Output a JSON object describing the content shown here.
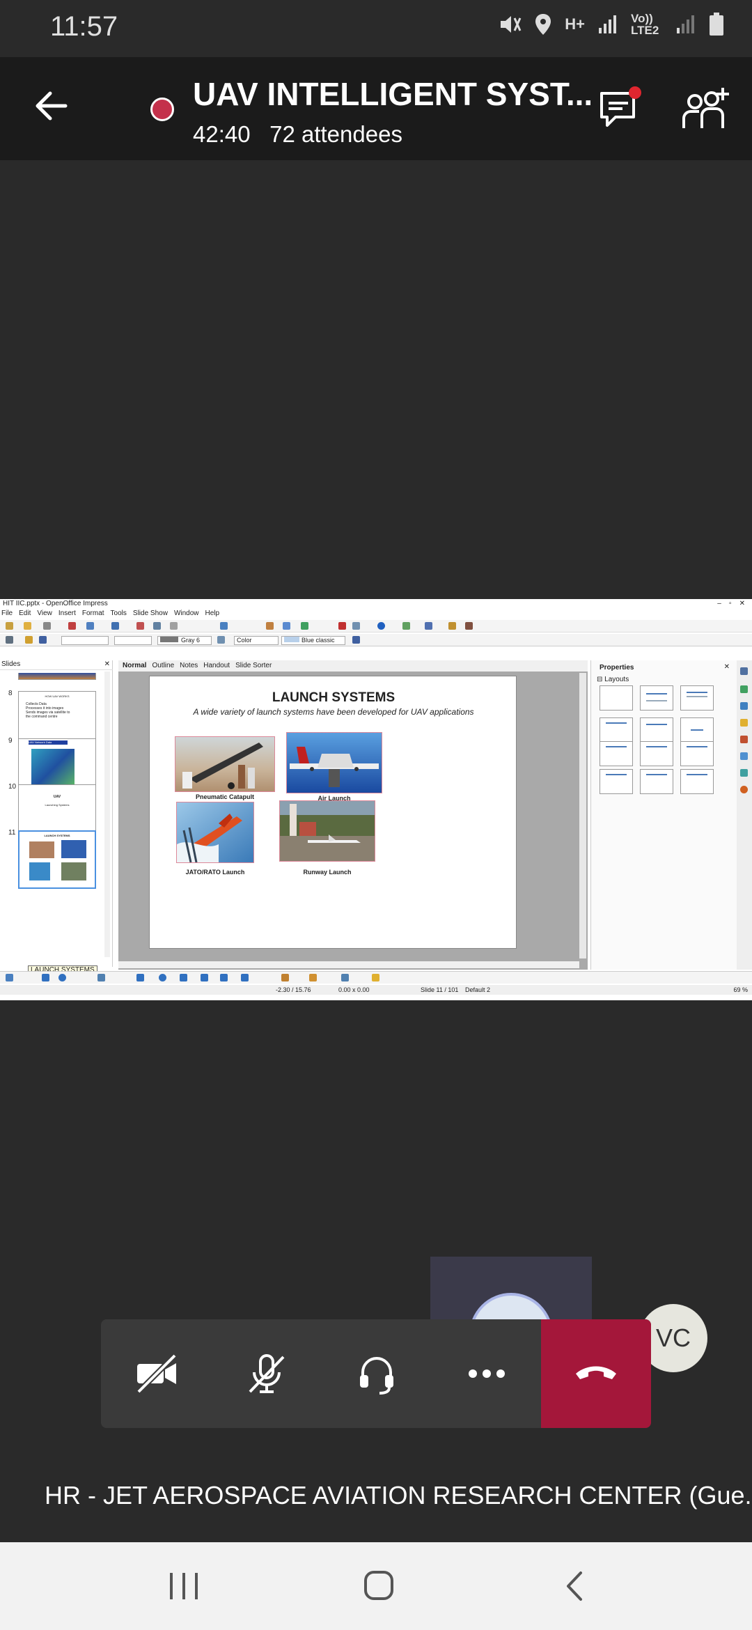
{
  "status_bar": {
    "time": "11:57",
    "network": "H+",
    "volte": "Vo)) LTE2"
  },
  "meeting": {
    "title": "UAV INTELLIGENT SYST...",
    "duration": "42:40",
    "attendees": "72 attendees"
  },
  "share": {
    "window_title": "HIT IIC.pptx - OpenOffice Impress",
    "menu": [
      "File",
      "Edit",
      "View",
      "Insert",
      "Format",
      "Tools",
      "Slide Show",
      "Window",
      "Help"
    ],
    "toolbar": {
      "area_color": "Gray 6",
      "mode": "Color",
      "theme": "Blue classic"
    },
    "slides_panel_label": "Slides",
    "thumbnails": [
      {
        "num": "8",
        "title": "HOW UAV WORKS",
        "body": "Collects Data\nProcesses it into images\nSends images via satellite to\nthe command centre"
      },
      {
        "num": "9",
        "title": "UAV Network Data"
      },
      {
        "num": "10",
        "title": "UAV",
        "body": "Launching Systems"
      },
      {
        "num": "11",
        "title": "LAUNCH SYSTEMS"
      }
    ],
    "tooltip": "LAUNCH SYSTEMS",
    "view_tabs": [
      "Normal",
      "Outline",
      "Notes",
      "Handout",
      "Slide Sorter"
    ],
    "slide": {
      "title": "LAUNCH SYSTEMS",
      "subtitle": "A wide variety of launch systems have been developed for UAV applications",
      "captions": [
        "Pneumatic Catapult",
        "Air Launch",
        "JATO/RATO Launch",
        "Runway Launch"
      ]
    },
    "properties": {
      "title": "Properties",
      "section": "Layouts"
    },
    "statusbar": {
      "position": "-2.30 / 15.76",
      "size": "0.00 x 0.00",
      "slide": "Slide 11 / 101",
      "master": "Default 2",
      "zoom": "69 %"
    }
  },
  "participants": {
    "initials": "VC"
  },
  "presenter_caption": "HR - JET AEROSPACE AVIATION RESEARCH CENTER (Gue...",
  "colors": {
    "recording": "#c4314b",
    "hangup": "#a4173a",
    "control_bar": "#3a3a3a",
    "header": "#1b1b1b"
  },
  "icons": [
    "back-arrow-icon",
    "recording-icon",
    "chat-icon",
    "add-people-icon",
    "camera-off-icon",
    "mic-off-icon",
    "headset-icon",
    "more-icon",
    "hang-up-icon",
    "recent-apps-icon",
    "home-icon",
    "back-nav-icon"
  ]
}
